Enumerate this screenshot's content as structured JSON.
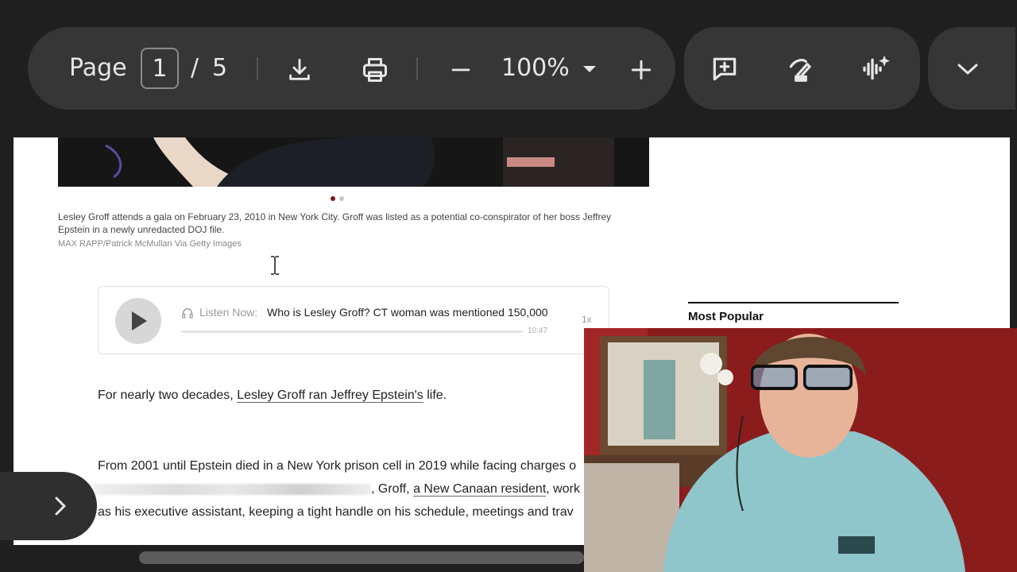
{
  "toolbar": {
    "page_label": "Page",
    "current_page": "1",
    "page_separator": "/",
    "total_pages": "5",
    "zoom": "100%",
    "icons": [
      "download-icon",
      "print-icon",
      "zoom-out-icon",
      "zoom-dropdown-icon",
      "zoom-in-icon",
      "add-comment-icon",
      "draw-icon",
      "read-aloud-icon",
      "more-chevron-icon"
    ]
  },
  "article": {
    "caption": "Lesley Groff attends a gala on February 23, 2010 in New York City. Groff was listed as a potential co-conspirator of her boss Jeffrey Epstein in a newly unredacted DOJ file.",
    "credit": "MAX RAPP/Patrick McMullan Via Getty Images",
    "carousel_dots": 2,
    "carousel_active": 0,
    "player": {
      "listen_label": "Listen Now:",
      "title": "Who is Lesley Groff? CT woman was mentioned 150,000",
      "duration": "10:47",
      "speed": "1x"
    },
    "paragraph1_prefix": "For nearly two decades, ",
    "paragraph1_link": "Lesley Groff ran Jeffrey Epstein's",
    "paragraph1_suffix": " life.",
    "paragraph2_line1": "From 2001 until Epstein died in a New York prison cell in 2019 while facing charges o",
    "paragraph2_line2_mid": ", Groff, ",
    "paragraph2_link": "a New Canaan resident",
    "paragraph2_line2_end": ", work",
    "paragraph2_line3": "as his executive assistant, keeping a tight handle on his schedule, meetings and trav"
  },
  "sidebar": {
    "heading": "Most Popular"
  },
  "colors": {
    "toolbar_bg": "#363637",
    "app_bg": "#1f1f1f",
    "accent_dot": "#7a1a1a",
    "webcam_wall": "#8b1c1c"
  }
}
